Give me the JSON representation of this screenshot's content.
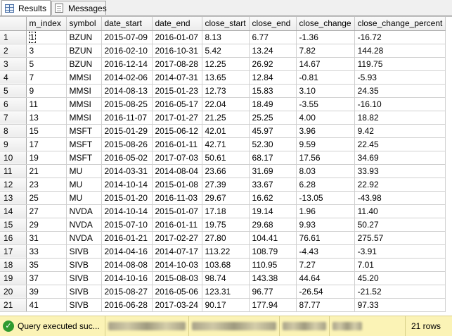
{
  "tabs": [
    {
      "label": "Results",
      "icon": "results-grid-icon",
      "active": true
    },
    {
      "label": "Messages",
      "icon": "messages-icon",
      "active": false
    }
  ],
  "grid": {
    "columns": [
      "m_index",
      "symbol",
      "date_start",
      "date_end",
      "close_start",
      "close_end",
      "close_change",
      "close_change_percent"
    ],
    "rows": [
      [
        "1",
        "BZUN",
        "2015-07-09",
        "2016-01-07",
        "8.13",
        "6.77",
        "-1.36",
        "-16.72"
      ],
      [
        "3",
        "BZUN",
        "2016-02-10",
        "2016-10-31",
        "5.42",
        "13.24",
        "7.82",
        "144.28"
      ],
      [
        "5",
        "BZUN",
        "2016-12-14",
        "2017-08-28",
        "12.25",
        "26.92",
        "14.67",
        "119.75"
      ],
      [
        "7",
        "MMSI",
        "2014-02-06",
        "2014-07-31",
        "13.65",
        "12.84",
        "-0.81",
        "-5.93"
      ],
      [
        "9",
        "MMSI",
        "2014-08-13",
        "2015-01-23",
        "12.73",
        "15.83",
        "3.10",
        "24.35"
      ],
      [
        "11",
        "MMSI",
        "2015-08-25",
        "2016-05-17",
        "22.04",
        "18.49",
        "-3.55",
        "-16.10"
      ],
      [
        "13",
        "MMSI",
        "2016-11-07",
        "2017-01-27",
        "21.25",
        "25.25",
        "4.00",
        "18.82"
      ],
      [
        "15",
        "MSFT",
        "2015-01-29",
        "2015-06-12",
        "42.01",
        "45.97",
        "3.96",
        "9.42"
      ],
      [
        "17",
        "MSFT",
        "2015-08-26",
        "2016-01-11",
        "42.71",
        "52.30",
        "9.59",
        "22.45"
      ],
      [
        "19",
        "MSFT",
        "2016-05-02",
        "2017-07-03",
        "50.61",
        "68.17",
        "17.56",
        "34.69"
      ],
      [
        "21",
        "MU",
        "2014-03-31",
        "2014-08-04",
        "23.66",
        "31.69",
        "8.03",
        "33.93"
      ],
      [
        "23",
        "MU",
        "2014-10-14",
        "2015-01-08",
        "27.39",
        "33.67",
        "6.28",
        "22.92"
      ],
      [
        "25",
        "MU",
        "2015-01-20",
        "2016-11-03",
        "29.67",
        "16.62",
        "-13.05",
        "-43.98"
      ],
      [
        "27",
        "NVDA",
        "2014-10-14",
        "2015-01-07",
        "17.18",
        "19.14",
        "1.96",
        "11.40"
      ],
      [
        "29",
        "NVDA",
        "2015-07-10",
        "2016-01-11",
        "19.75",
        "29.68",
        "9.93",
        "50.27"
      ],
      [
        "31",
        "NVDA",
        "2016-01-21",
        "2017-02-27",
        "27.80",
        "104.41",
        "76.61",
        "275.57"
      ],
      [
        "33",
        "SIVB",
        "2014-04-16",
        "2014-07-17",
        "113.22",
        "108.79",
        "-4.43",
        "-3.91"
      ],
      [
        "35",
        "SIVB",
        "2014-08-08",
        "2014-10-03",
        "103.68",
        "110.95",
        "7.27",
        "7.01"
      ],
      [
        "37",
        "SIVB",
        "2014-10-16",
        "2015-08-03",
        "98.74",
        "143.38",
        "44.64",
        "45.20"
      ],
      [
        "39",
        "SIVB",
        "2015-08-27",
        "2016-05-06",
        "123.31",
        "96.77",
        "-26.54",
        "-21.52"
      ],
      [
        "41",
        "SIVB",
        "2016-06-28",
        "2017-03-24",
        "90.17",
        "177.94",
        "87.77",
        "97.33"
      ]
    ]
  },
  "status": {
    "message": "Query executed suc...",
    "icon": "success-check-icon",
    "rows_label": "21 rows",
    "background_color": "#fbf3b6"
  }
}
